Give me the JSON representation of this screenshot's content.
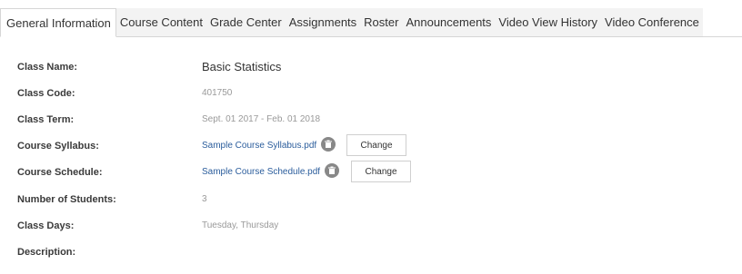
{
  "tabs": [
    {
      "label": "General Information",
      "active": true
    },
    {
      "label": "Course Content",
      "active": false
    },
    {
      "label": "Grade Center",
      "active": false
    },
    {
      "label": "Assignments",
      "active": false
    },
    {
      "label": "Roster",
      "active": false
    },
    {
      "label": "Announcements",
      "active": false
    },
    {
      "label": "Video View History",
      "active": false
    },
    {
      "label": "Video Conference",
      "active": false
    }
  ],
  "form": {
    "class_name": {
      "label": "Class Name:",
      "value": "Basic Statistics"
    },
    "class_code": {
      "label": "Class Code:",
      "value": "401750"
    },
    "class_term": {
      "label": "Class Term:",
      "value": "Sept. 01 2017 - Feb. 01 2018"
    },
    "course_syllabus": {
      "label": "Course Syllabus:",
      "file": "Sample Course Syllabus.pdf",
      "button": "Change"
    },
    "course_schedule": {
      "label": "Course Schedule:",
      "file": "Sample Course Schedule.pdf",
      "button": "Change"
    },
    "number_of_students": {
      "label": "Number of Students:",
      "value": "3"
    },
    "class_days": {
      "label": "Class Days:",
      "value": "Tuesday, Thursday"
    },
    "description": {
      "label": "Description:",
      "value": ""
    }
  },
  "colors": {
    "link": "#2b5d9c",
    "muted_text": "#999999",
    "tab_inactive_bg": "#f3f3f3",
    "icon_grey": "#888888"
  },
  "icons": {
    "file_delete": "trash-icon"
  }
}
